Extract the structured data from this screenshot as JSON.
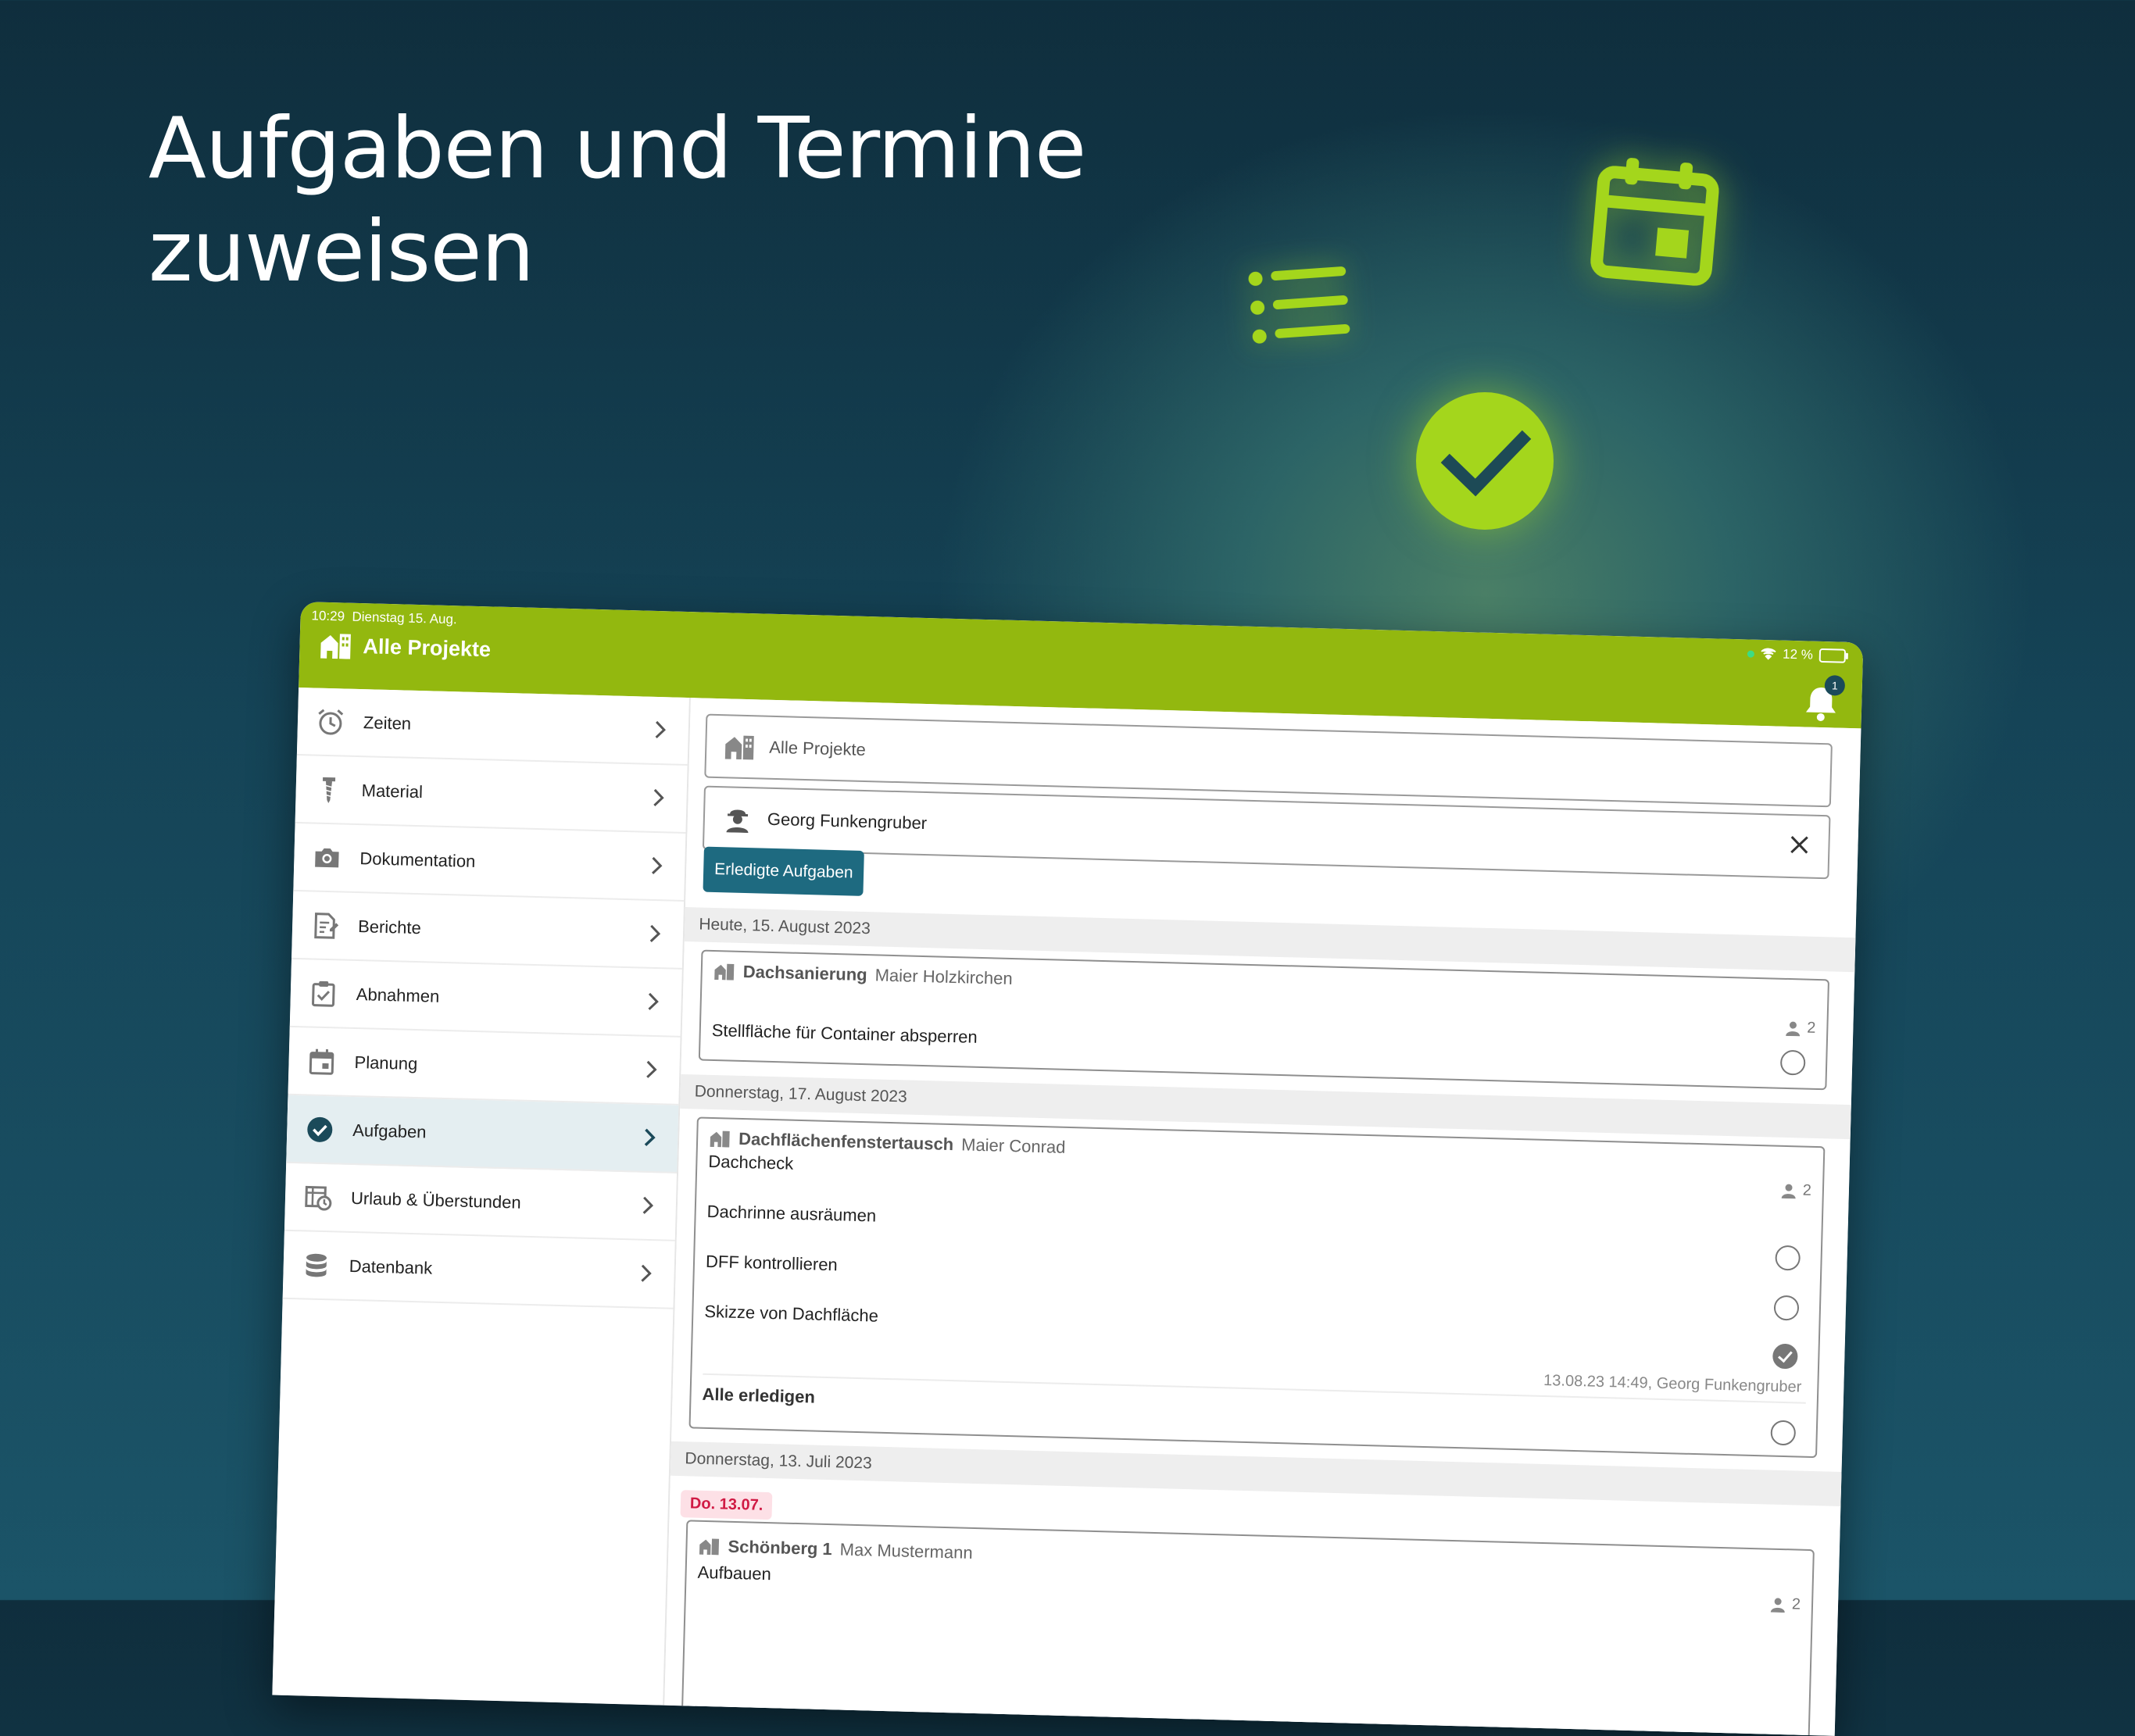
{
  "headline": {
    "line1": "Aufgaben und Termine",
    "line2": "zuweisen"
  },
  "colors": {
    "accent": "#93b80f",
    "primary": "#1e6a80",
    "overdue": "#d01a44"
  },
  "status": {
    "time": "10:29",
    "date": "Dienstag 15. Aug.",
    "battery": "12 %"
  },
  "appbar": {
    "title": "Alle Projekte",
    "notifications": "1"
  },
  "sidebar": {
    "items": [
      {
        "label": "Zeiten",
        "icon": "alarm-clock-icon"
      },
      {
        "label": "Material",
        "icon": "screw-icon"
      },
      {
        "label": "Dokumentation",
        "icon": "camera-icon"
      },
      {
        "label": "Berichte",
        "icon": "report-icon"
      },
      {
        "label": "Abnahmen",
        "icon": "clipboard-check-icon"
      },
      {
        "label": "Planung",
        "icon": "calendar-icon"
      },
      {
        "label": "Aufgaben",
        "icon": "check-circle-icon",
        "active": true
      },
      {
        "label": "Urlaub & Überstunden",
        "icon": "vacation-icon"
      },
      {
        "label": "Datenbank",
        "icon": "database-icon"
      }
    ]
  },
  "filters": {
    "project": "Alle Projekte",
    "person": "Georg Funkengruber",
    "done_button": "Erledigte Aufgaben"
  },
  "groups": [
    {
      "date": "Heute, 15. August 2023",
      "card": {
        "project": "Dachsanierung",
        "client": "Maier Holzkirchen",
        "people": "2",
        "task": "Stellfläche für Container absperren"
      }
    },
    {
      "date": "Donnerstag, 17. August 2023",
      "card": {
        "project": "Dachflächenfenstertausch",
        "client": "Maier Conrad",
        "title": "Dachcheck",
        "people": "2",
        "tasks": [
          "Dachrinne ausräumen",
          "DFF kontrollieren",
          "Skizze von Dachfläche"
        ],
        "done_meta": "13.08.23 14:49, Georg Funkengruber",
        "all_done": "Alle erledigen"
      }
    },
    {
      "date": "Donnerstag, 13. Juli 2023",
      "card": {
        "badge": "Do. 13.07.",
        "project": "Schönberg 1",
        "client": "Max Mustermann",
        "title": "Aufbauen",
        "people": "2"
      }
    }
  ]
}
